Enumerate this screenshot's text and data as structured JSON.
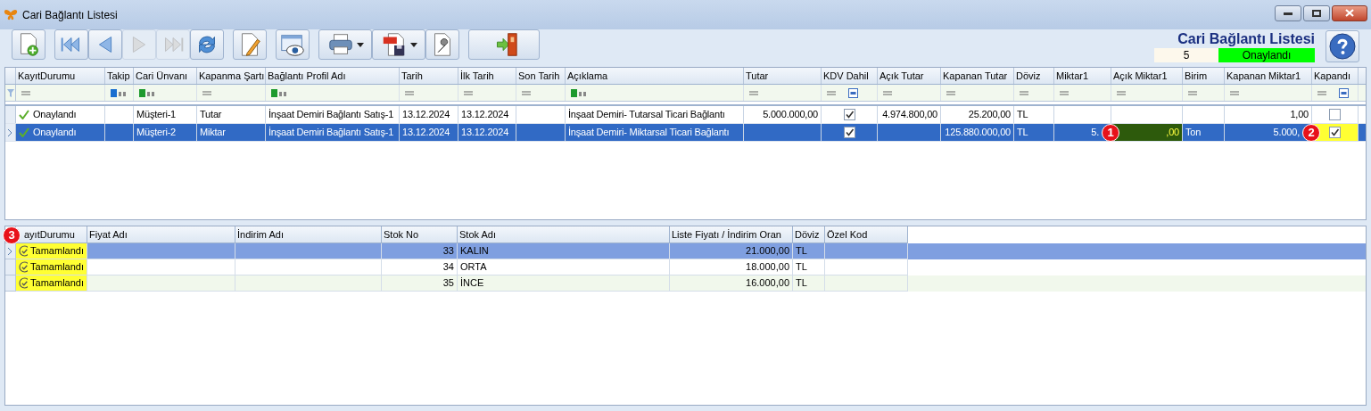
{
  "window": {
    "title": "Cari Bağlantı Listesi"
  },
  "toolbar": [
    [
      {
        "kind": "new",
        "disabled": false
      }
    ],
    [
      {
        "kind": "first",
        "disabled": false
      },
      {
        "kind": "prev",
        "disabled": false
      },
      {
        "kind": "next",
        "disabled": true
      },
      {
        "kind": "last",
        "disabled": true
      },
      {
        "kind": "refresh",
        "disabled": false
      }
    ],
    [
      {
        "kind": "edit",
        "disabled": false
      }
    ],
    [
      {
        "kind": "preview",
        "disabled": false
      }
    ],
    [
      {
        "kind": "print",
        "disabled": false
      },
      {
        "kind": "pdf",
        "disabled": false
      },
      {
        "kind": "settings",
        "disabled": false
      }
    ],
    [
      {
        "kind": "exit",
        "disabled": false
      }
    ]
  ],
  "header": {
    "title": "Cari Bağlantı Listesi",
    "count": "5",
    "status": "Onaylandı"
  },
  "main_grid": {
    "columns": [
      {
        "label": "KayıtDurumu",
        "kind": "equals"
      },
      {
        "label": "Takip",
        "kind": "text",
        "color": "#1a6fd0"
      },
      {
        "label": "Cari Ünvanı",
        "kind": "text",
        "color": "#1e9a2e"
      },
      {
        "label": "Kapanma Şartı",
        "kind": "equals"
      },
      {
        "label": "Bağlantı Profil Adı",
        "kind": "text",
        "color": "#1e9a2e"
      },
      {
        "label": "Tarih",
        "kind": "equals"
      },
      {
        "label": "İlk Tarih",
        "kind": "equals"
      },
      {
        "label": "Son Tarih",
        "kind": "equals"
      },
      {
        "label": "Açıklama",
        "kind": "text",
        "color": "#1e9a2e"
      },
      {
        "label": "Tutar",
        "kind": "equals"
      },
      {
        "label": "KDV Dahil",
        "kind": "check"
      },
      {
        "label": "Açık Tutar",
        "kind": "equals"
      },
      {
        "label": "Kapanan Tutar",
        "kind": "equals"
      },
      {
        "label": "Döviz",
        "kind": "equals"
      },
      {
        "label": "Miktar1",
        "kind": "equals"
      },
      {
        "label": "Açık Miktar1",
        "kind": "equals"
      },
      {
        "label": "Birim",
        "kind": "equals"
      },
      {
        "label": "Kapanan Miktar1",
        "kind": "equals"
      },
      {
        "label": "Kapandı",
        "kind": "check"
      }
    ],
    "rows": [
      {
        "selected": false,
        "cells": [
          {
            "text": "Onaylandı"
          },
          {},
          {
            "text": "Müşteri-1"
          },
          {
            "text": "Tutar"
          },
          {
            "text": "İnşaat Demiri Bağlantı Satış-1"
          },
          {
            "text": "13.12.2024"
          },
          {
            "text": "13.12.2024"
          },
          {},
          {
            "text": "İnşaat Demiri- Tutarsal Ticari Bağlantı"
          },
          {
            "text": "5.000.000,00"
          },
          {
            "checked": true
          },
          {
            "text": "4.974.800,00"
          },
          {
            "text": "25.200,00"
          },
          {
            "text": "TL"
          },
          {},
          {},
          {},
          {
            "text": "1,00"
          },
          {
            "checked": false
          }
        ]
      },
      {
        "selected": true,
        "cells": [
          {
            "text": "Onaylandı"
          },
          {},
          {
            "text": "Müşteri-2"
          },
          {
            "text": "Miktar"
          },
          {
            "text": "İnşaat Demiri Bağlantı Satış-1"
          },
          {
            "text": "13.12.2024"
          },
          {
            "text": "13.12.2024"
          },
          {},
          {
            "text": "İnşaat Demiri- Miktarsal Ticari Bağlantı"
          },
          {},
          {
            "checked": true
          },
          {},
          {
            "text": "125.880.000,00"
          },
          {
            "text": "TL"
          },
          {
            "text": "5.",
            "marker": "1"
          },
          {
            "text": ",00",
            "highlighted": true
          },
          {
            "text": "Ton"
          },
          {
            "text": "5.000,",
            "marker": "2"
          },
          {
            "checked": true,
            "highlighted": true
          }
        ]
      }
    ]
  },
  "detail_grid": {
    "marker": "3",
    "columns": [
      "ayıtDurumu",
      "Fiyat Adı",
      "İndirim Adı",
      "Stok No",
      "Stok Adı",
      "Liste Fiyatı / İndirim Oran",
      "Döviz",
      "Özel Kod"
    ],
    "rows": [
      {
        "selected": true,
        "cells": [
          {
            "text": "Tamamlandı",
            "highlighted": true
          },
          {},
          {},
          {
            "text": "33"
          },
          {
            "text": "KALIN"
          },
          {
            "text": "21.000,00"
          },
          {
            "text": "TL"
          },
          {}
        ]
      },
      {
        "selected": false,
        "cells": [
          {
            "text": "Tamamlandı",
            "highlighted": true
          },
          {},
          {},
          {
            "text": "34"
          },
          {
            "text": "ORTA"
          },
          {
            "text": "18.000,00"
          },
          {
            "text": "TL"
          },
          {}
        ]
      },
      {
        "selected": false,
        "cells": [
          {
            "text": "Tamamlandı",
            "highlighted": true
          },
          {},
          {},
          {
            "text": "35"
          },
          {
            "text": "İNCE"
          },
          {
            "text": "16.000,00"
          },
          {
            "text": "TL"
          },
          {}
        ]
      }
    ]
  }
}
